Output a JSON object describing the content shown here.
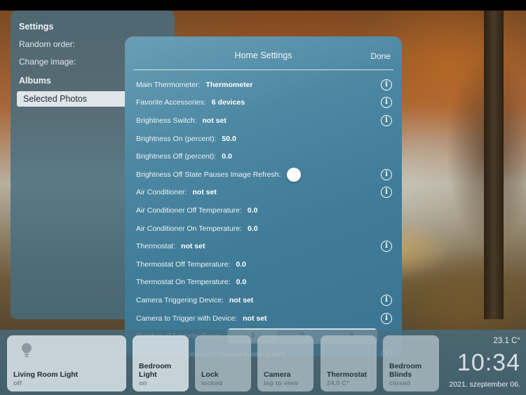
{
  "sidebar": {
    "settings_heading": "Settings",
    "random_order_label": "Random order:",
    "change_image_label": "Change image:",
    "albums_heading": "Albums",
    "selected_album": "Selected Photos"
  },
  "modal": {
    "title": "Home Settings",
    "done_label": "Done",
    "rows": [
      {
        "label": "Main Thermometer:",
        "value": "Thermometer",
        "info": true
      },
      {
        "label": "Favorite Accessories:",
        "value": "6 devices",
        "info": true
      },
      {
        "label": "Brightness Switch:",
        "value": "not set",
        "info": true
      },
      {
        "label": "Brightness On (percent):",
        "value": "50.0",
        "info": false
      },
      {
        "label": "Brightness Off (percent):",
        "value": "0.0",
        "info": false
      },
      {
        "label": "Brightness Off State Pauses Image Refresh:",
        "value": "",
        "info": true,
        "toggle": "off"
      },
      {
        "label": "Air Conditioner:",
        "value": "not set",
        "info": true
      },
      {
        "label": "Air Conditioner Off Temperature:",
        "value": "0.0",
        "info": false
      },
      {
        "label": "Air Conditioner On Temperature:",
        "value": "0.0",
        "info": false
      },
      {
        "label": "Thermostat:",
        "value": "not set",
        "info": true
      },
      {
        "label": "Thermostat Off Temperature:",
        "value": "0.0",
        "info": false
      },
      {
        "label": "Thermostat On Temperature:",
        "value": "0.0",
        "info": false
      },
      {
        "label": "Camera Triggering Device:",
        "value": "not set",
        "info": true
      },
      {
        "label": "Camera to Trigger with Device:",
        "value": "not set",
        "info": true
      },
      {
        "label": "Number of Favorite Rows:",
        "value": "",
        "info": false
      },
      {
        "label": "Accentuated Accessory:",
        "value": "Living Room Light",
        "info": true
      }
    ],
    "favorite_rows_options": [
      "1",
      "2",
      "3"
    ],
    "favorite_rows_selected": "1",
    "info_glyph": "i"
  },
  "tiles": [
    {
      "name": "Living Room Light",
      "state": "off",
      "icon": "lightbulb-icon"
    },
    {
      "name": "Bedroom Light",
      "state": "on"
    },
    {
      "name": "Lock",
      "state": "locked"
    },
    {
      "name": "Camera",
      "state": "tap to view"
    },
    {
      "name": "Thermostat",
      "state": "24.0 C°"
    },
    {
      "name": "Bedroom Blinds",
      "state": "closed"
    }
  ],
  "status": {
    "temperature": "23.1 C°",
    "time": "10:34",
    "date": "2021. szeptember 06."
  }
}
